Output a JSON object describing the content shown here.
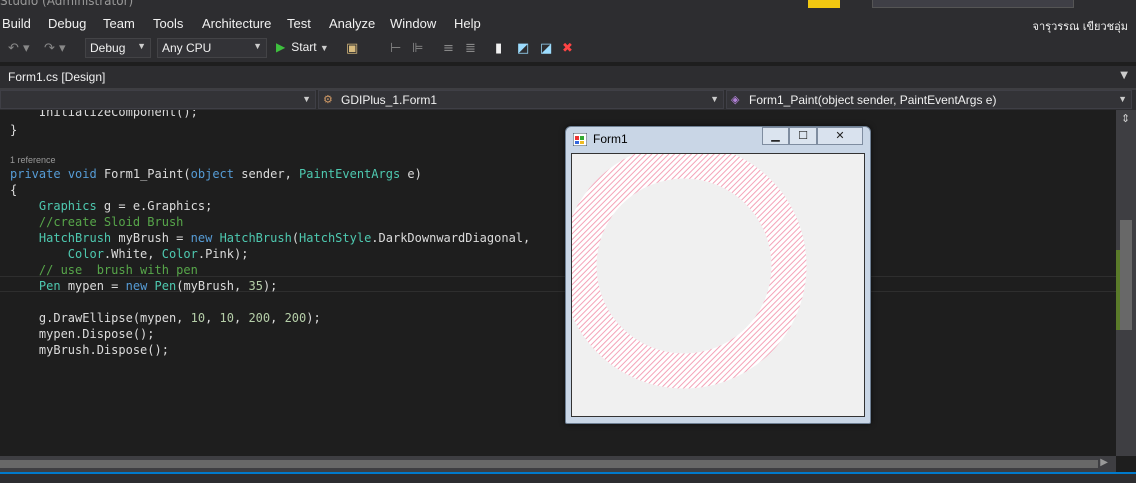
{
  "window_title": "Studio (Administrator)",
  "menu": [
    "Build",
    "Debug",
    "Team",
    "Tools",
    "Architecture",
    "Test",
    "Analyze",
    "Window",
    "Help"
  ],
  "user_name": "จารุวรรณ  เขียวชอุ่ม",
  "toolbar": {
    "configuration": "Debug",
    "platform": "Any CPU",
    "start_label": "Start"
  },
  "document_tab": "Form1.cs [Design]",
  "navigation": {
    "class": "GDIPlus_1.Form1",
    "member": "Form1_Paint(object sender, PaintEventArgs e)"
  },
  "code": {
    "codelens": "1 reference"
  },
  "form": {
    "title": "Form1",
    "pen_color": "#f4a3b8",
    "background": "#f0f0f0"
  },
  "colors": {
    "accent": "#007acc",
    "keyword": "#569cd6",
    "type": "#4ec9b0",
    "comment": "#57a64a"
  }
}
